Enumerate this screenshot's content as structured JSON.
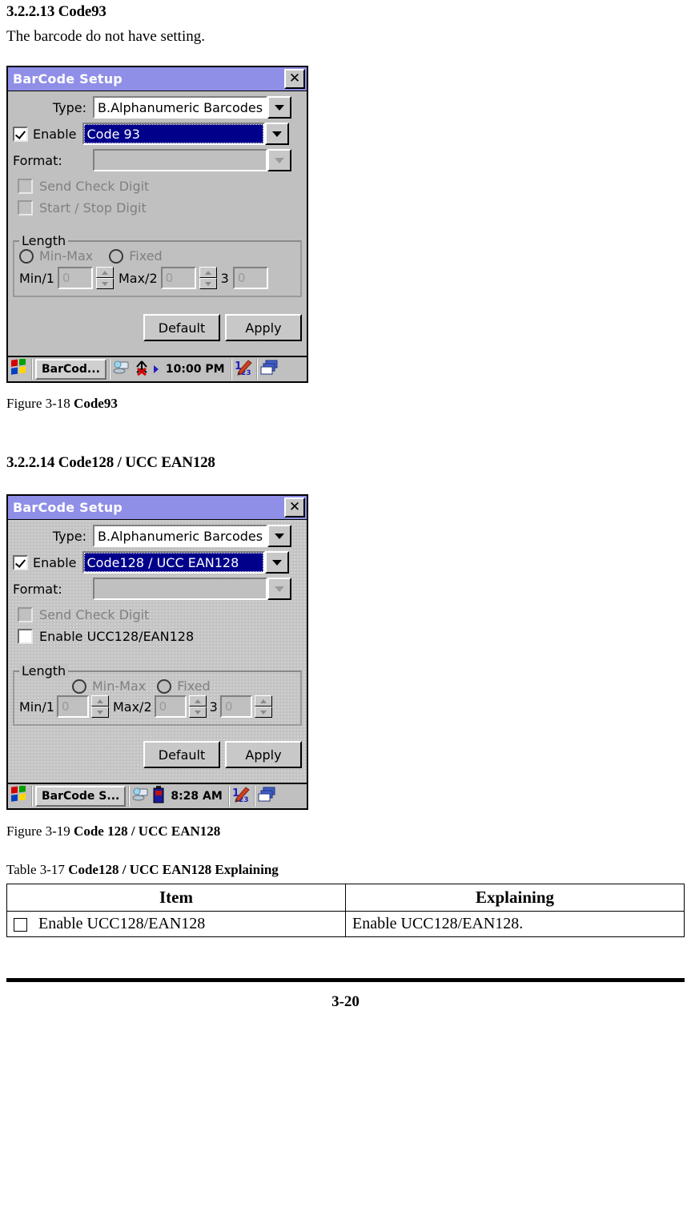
{
  "section1": {
    "heading": "3.2.2.13 Code93",
    "body": "The barcode do not have setting."
  },
  "dialog1": {
    "title": "BarCode Setup",
    "close_label": "✕",
    "type_label": "Type:",
    "type_value": "B.Alphanumeric Barcodes",
    "enable_label": "Enable",
    "enable_checked": true,
    "enable_value": "Code 93",
    "format_label": "Format:",
    "format_value": "",
    "check_send": "Send Check Digit",
    "check_startstop": "Start / Stop Digit",
    "length_title": "Length",
    "radio_minmax": "Min-Max",
    "radio_fixed": "Fixed",
    "min_label": "Min/1",
    "min_value": "0",
    "max_label": "Max/2",
    "max_value": "0",
    "third_label": "3",
    "third_value": "0",
    "default_btn": "Default",
    "apply_btn": "Apply",
    "taskbar": {
      "task_button": "BarCod...",
      "time": "10:00 PM"
    }
  },
  "caption1": {
    "prefix": "Figure 3-18 ",
    "bold": "Code93"
  },
  "section2": {
    "heading": "3.2.2.14 Code128 / UCC EAN128"
  },
  "dialog2": {
    "title": "BarCode Setup",
    "close_label": "✕",
    "type_label": "Type:",
    "type_value": "B.Alphanumeric Barcodes",
    "enable_label": "Enable",
    "enable_checked": true,
    "enable_value": "Code128 / UCC EAN128",
    "format_label": "Format:",
    "format_value": "",
    "check_send": "Send Check Digit",
    "check_ucc": "Enable UCC128/EAN128",
    "length_title": "Length",
    "radio_minmax": "Min-Max",
    "radio_fixed": "Fixed",
    "min_label": "Min/1",
    "min_value": "0",
    "max_label": "Max/2",
    "max_value": "0",
    "third_label": "3",
    "third_value": "0",
    "default_btn": "Default",
    "apply_btn": "Apply",
    "taskbar": {
      "task_button": "BarCode S...",
      "time": "8:28 AM"
    }
  },
  "caption2": {
    "prefix": "Figure 3-19 ",
    "bold": "Code 128 / UCC EAN128"
  },
  "table_caption": {
    "prefix": "Table 3-17 ",
    "bold": "Code128 / UCC EAN128 Explaining"
  },
  "table": {
    "headers": [
      "Item",
      "Explaining"
    ],
    "rows": [
      {
        "item": "Enable UCC128/EAN128",
        "explaining": "Enable UCC128/EAN128."
      }
    ]
  },
  "footer": {
    "page": "3-20"
  },
  "colors": {
    "titlebar": "#8f8fe8",
    "selection": "#00008b",
    "dialog_face": "#c0c0c0"
  }
}
